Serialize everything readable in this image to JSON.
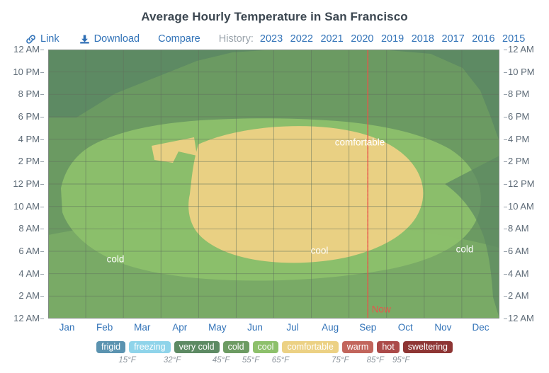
{
  "header": {
    "title": "Average Hourly Temperature in San Francisco"
  },
  "toolbar": {
    "link_label": "Link",
    "link_icon": "link-icon",
    "download_label": "Download",
    "download_icon": "download-icon",
    "compare_label": "Compare",
    "history_label": "History:",
    "years": [
      "2023",
      "2022",
      "2021",
      "2020",
      "2019",
      "2018",
      "2017",
      "2016",
      "2015"
    ]
  },
  "chart_data": {
    "type": "heatmap",
    "title": "Average Hourly Temperature in San Francisco",
    "xlabel": "",
    "ylabel": "",
    "grid": true,
    "legend_position": "bottom",
    "x_ticks": [
      "Jan",
      "Feb",
      "Mar",
      "Apr",
      "May",
      "Jun",
      "Jul",
      "Aug",
      "Sep",
      "Oct",
      "Nov",
      "Dec"
    ],
    "y_ticks": [
      "12 AM",
      "10 PM",
      "8 PM",
      "6 PM",
      "4 PM",
      "2 PM",
      "12 PM",
      "10 AM",
      "8 AM",
      "6 AM",
      "4 AM",
      "2 AM",
      "12 AM"
    ],
    "y_axis_note": "Hour of day, 12 AM at top down to 12 AM at bottom",
    "bands": [
      {
        "name": "frigid",
        "color": "#5b93b0",
        "min_f": null,
        "max_f": 15
      },
      {
        "name": "freezing",
        "color": "#8fd4ea",
        "min_f": 15,
        "max_f": 32
      },
      {
        "name": "very cold",
        "color": "#5d8a63",
        "min_f": 32,
        "max_f": 45
      },
      {
        "name": "cold",
        "color": "#6c9b62",
        "min_f": 45,
        "max_f": 55
      },
      {
        "name": "cool",
        "color": "#8dc06b",
        "min_f": 55,
        "max_f": 65
      },
      {
        "name": "comfortable",
        "color": "#ecd184",
        "min_f": 65,
        "max_f": 75
      },
      {
        "name": "warm",
        "color": "#c2655c",
        "min_f": 75,
        "max_f": 85
      },
      {
        "name": "hot",
        "color": "#ab4a49",
        "min_f": 85,
        "max_f": 95
      },
      {
        "name": "sweltering",
        "color": "#8e3534",
        "min_f": 95,
        "max_f": null
      }
    ],
    "region_labels": [
      {
        "text": "cold",
        "x_month": "Feb",
        "y_hour": "5 AM"
      },
      {
        "text": "cool",
        "x_month": "Aug",
        "y_hour": "6 AM"
      },
      {
        "text": "cold",
        "x_month": "Nov",
        "y_hour": "6 AM"
      },
      {
        "text": "comfortable",
        "x_month": "Aug",
        "y_hour": "4 PM"
      }
    ],
    "now_marker": {
      "label": "Now",
      "x_month": "Sep",
      "color": "#e8544a"
    }
  },
  "legend": {
    "items": [
      {
        "label": "frigid",
        "color": "#5b93b0"
      },
      {
        "label": "freezing",
        "color": "#8fd4ea"
      },
      {
        "label": "very cold",
        "color": "#5d8a63"
      },
      {
        "label": "cold",
        "color": "#6c9b62"
      },
      {
        "label": "cool",
        "color": "#8dc06b"
      },
      {
        "label": "comfortable",
        "color": "#ecd184"
      },
      {
        "label": "warm",
        "color": "#c2655c"
      },
      {
        "label": "hot",
        "color": "#ab4a49"
      },
      {
        "label": "sweltering",
        "color": "#8e3534"
      }
    ],
    "ticks": [
      "15°F",
      "32°F",
      "45°F",
      "55°F",
      "65°F",
      "75°F",
      "85°F",
      "95°F"
    ]
  }
}
